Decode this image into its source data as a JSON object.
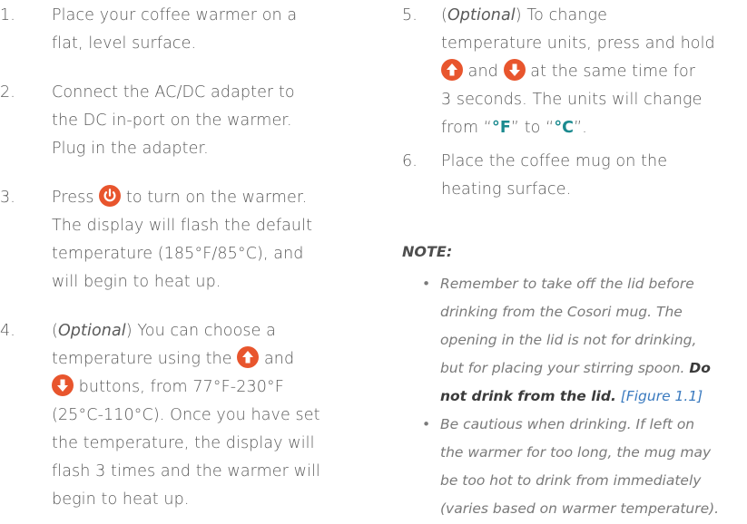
{
  "steps": {
    "s1": {
      "num": "1.",
      "l1": "Place your coffee warmer on a",
      "l2": "flat, level surface."
    },
    "s2": {
      "num": "2.",
      "l1": "Connect the AC/DC adapter to",
      "l2": "the DC in-port on the warmer.",
      "l3": "Plug in the adapter."
    },
    "s3": {
      "num": "3.",
      "l1a": "Press",
      "l1b": "to turn on the warmer.",
      "l2": "The display will flash the default",
      "l3": "temperature (185°F/85°C), and",
      "l4": "will begin to heat up."
    },
    "s4": {
      "num": "4.",
      "l1a": "(",
      "l1opt": "Optional",
      "l1b": ") You can choose a",
      "l2a": "temperature using the",
      "l2b": "and",
      "l3": "buttons, from 77°F-230°F",
      "l4": "(25°C-110°C). Once you have set",
      "l5": "the temperature, the display will",
      "l6": "flash 3 times and the warmer will",
      "l7": "begin to heat up."
    },
    "s5": {
      "num": "5.",
      "l1a": "(",
      "l1opt": "Optional",
      "l1b": ") To change",
      "l2": "temperature units, press and hold",
      "l3a": "and",
      "l3b": "at the same time for",
      "l4": "3 seconds. The units will change",
      "l5a": "from “",
      "l5f": "°F",
      "l5b": "” to “",
      "l5c": "°C",
      "l5d": "”."
    },
    "s6": {
      "num": "6.",
      "l1": "Place the coffee mug on the",
      "l2": "heating surface."
    }
  },
  "note": {
    "title": "NOTE:",
    "bullet1": {
      "l1": "Remember to take off the lid before",
      "l2": "drinking from the Cosori mug. The",
      "l3": "opening in the lid is not for drinking,",
      "l4a": "but for placing your stirring spoon. ",
      "l4b": "Do",
      "l5a": "not drink from the lid.",
      "l5b": "[Figure 1.1]"
    },
    "bullet2": {
      "l1": "Be cautious when drinking. If left on",
      "l2": "the warmer for too long, the mug may",
      "l3": "be too hot to drink from immediately",
      "l4": "(varies based on warmer temperature)."
    }
  },
  "icons": {
    "accent": "#e8552d",
    "teal": "#1b8a8f"
  }
}
